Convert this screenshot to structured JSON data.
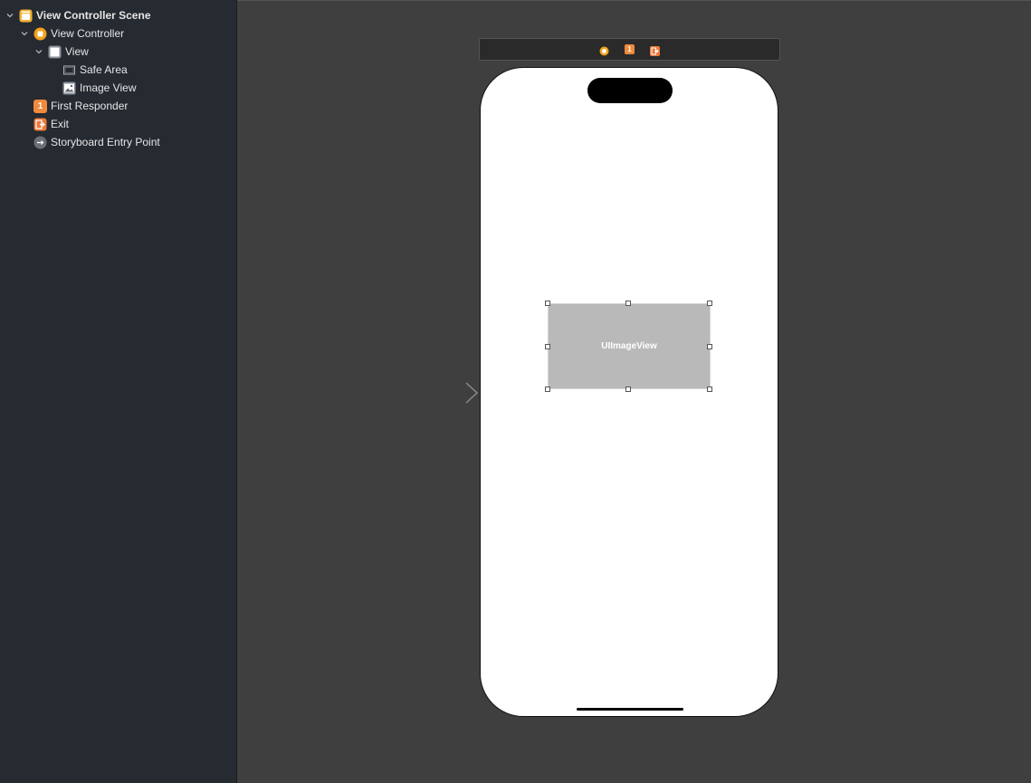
{
  "outline": {
    "scene_label": "View Controller Scene",
    "view_controller_label": "View Controller",
    "view_label": "View",
    "safe_area_label": "Safe Area",
    "image_view_label": "Image View",
    "first_responder_label": "First Responder",
    "first_responder_badge": "1",
    "exit_label": "Exit",
    "entry_point_label": "Storyboard Entry Point"
  },
  "dock": {
    "first_responder_badge": "1"
  },
  "canvas": {
    "image_view_label": "UIImageView"
  },
  "colors": {
    "sidebar_bg": "#262a31",
    "canvas_bg": "#3f3f3f",
    "scene_icon": "#f2b233",
    "view_controller_icon": "#f0a21a",
    "first_responder_icon": "#f08a3c",
    "exit_icon": "#ee7a3b",
    "entry_point_icon": "#6b6f76",
    "image_view_fill": "#b9b9b9"
  },
  "icons": {
    "scene": "scene-icon",
    "view_controller": "view-controller-icon",
    "view": "view-icon",
    "safe_area": "safe-area-icon",
    "image_view": "image-view-icon",
    "first_responder": "first-responder-icon",
    "exit": "exit-icon",
    "entry_point": "entry-point-icon"
  }
}
